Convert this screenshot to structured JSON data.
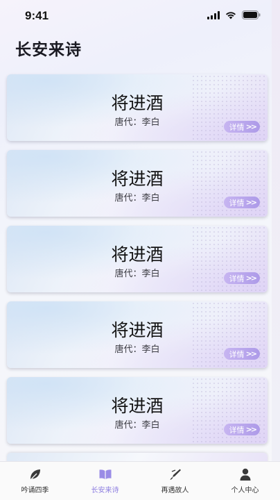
{
  "status_bar": {
    "time": "9:41",
    "icons": [
      "signal-icon",
      "wifi-icon",
      "battery-icon"
    ]
  },
  "page": {
    "title": "长安来诗"
  },
  "cards": [
    {
      "title": "将进酒",
      "author": "唐代：李白",
      "detail_label": "详情"
    },
    {
      "title": "将进酒",
      "author": "唐代：李白",
      "detail_label": "详情"
    },
    {
      "title": "将进酒",
      "author": "唐代：李白",
      "detail_label": "详情"
    },
    {
      "title": "将进酒",
      "author": "唐代：李白",
      "detail_label": "详情"
    },
    {
      "title": "将进酒",
      "author": "唐代：李白",
      "detail_label": "详情"
    }
  ],
  "tab_bar": {
    "active_index": 1,
    "items": [
      {
        "label": "吟诵四季",
        "icon": "leaf-icon"
      },
      {
        "label": "长安来诗",
        "icon": "open-book-icon"
      },
      {
        "label": "再遇故人",
        "icon": "pen-nib-icon"
      },
      {
        "label": "个人中心",
        "icon": "user-icon"
      }
    ]
  },
  "colors": {
    "accent": "#8e7fe0",
    "detail_button": "#b9a7ee",
    "tab_icon": "#3a3a3a"
  }
}
